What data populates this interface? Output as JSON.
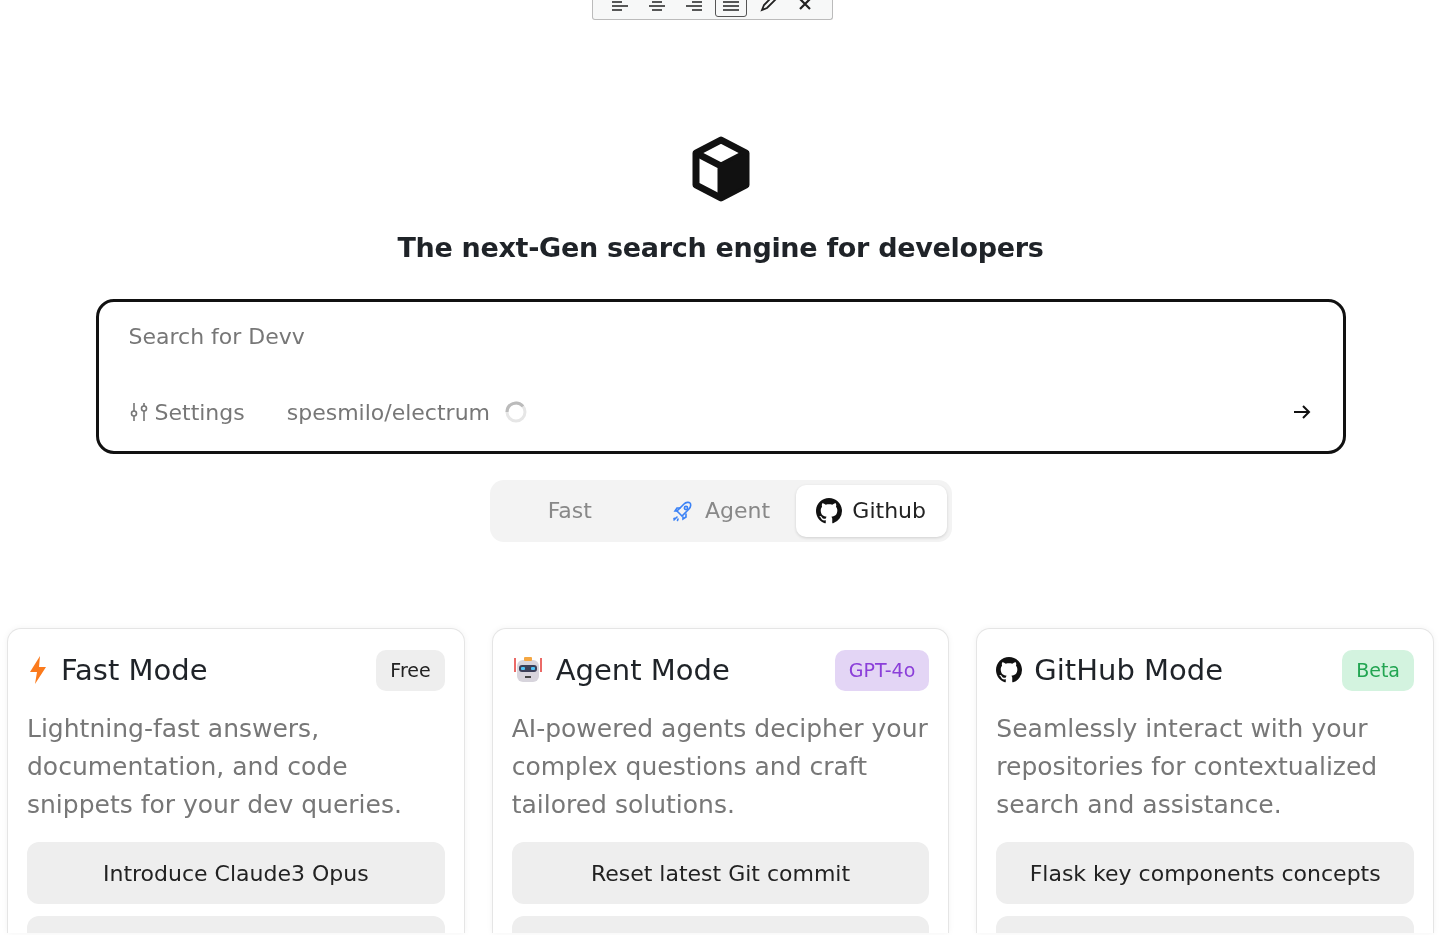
{
  "toolbar": {
    "tools": [
      {
        "kind": "align-left",
        "selected": false
      },
      {
        "kind": "align-center",
        "selected": false
      },
      {
        "kind": "align-right",
        "selected": false
      },
      {
        "kind": "align-justify",
        "selected": true
      },
      {
        "kind": "pen",
        "selected": false
      },
      {
        "kind": "close",
        "selected": false
      }
    ]
  },
  "headline": "The next-Gen search engine for developers",
  "search": {
    "placeholder": "Search for Devv",
    "settings_label": "Settings",
    "repository": "spesmilo/electrum",
    "loading": true
  },
  "modes": [
    {
      "label": "Fast",
      "kind": "plain",
      "selected": false
    },
    {
      "label": "Agent",
      "kind": "rocket",
      "selected": false
    },
    {
      "label": "Github",
      "kind": "github",
      "selected": true
    }
  ],
  "cards": [
    {
      "kind": "bolt",
      "title": "Fast Mode",
      "badge": "Free",
      "color": "#eeeeee",
      "description": "Lightning-fast answers, documentation, and code snippets for your dev queries.",
      "suggestions": [
        "Introduce Claude3 Opus"
      ]
    },
    {
      "kind": "robot",
      "title": "Agent Mode",
      "badge": "GPT-4o",
      "color": "#e3d5f5",
      "description": "AI-powered agents decipher your complex questions and craft tailored solutions.",
      "suggestions": [
        "Reset latest Git commit"
      ]
    },
    {
      "kind": "github",
      "title": "GitHub Mode",
      "badge": "Beta",
      "color": "#d3f3df",
      "description": "Seamlessly interact with your repositories for contextualized search and assistance.",
      "suggestions": [
        "Flask key components concepts"
      ]
    }
  ]
}
